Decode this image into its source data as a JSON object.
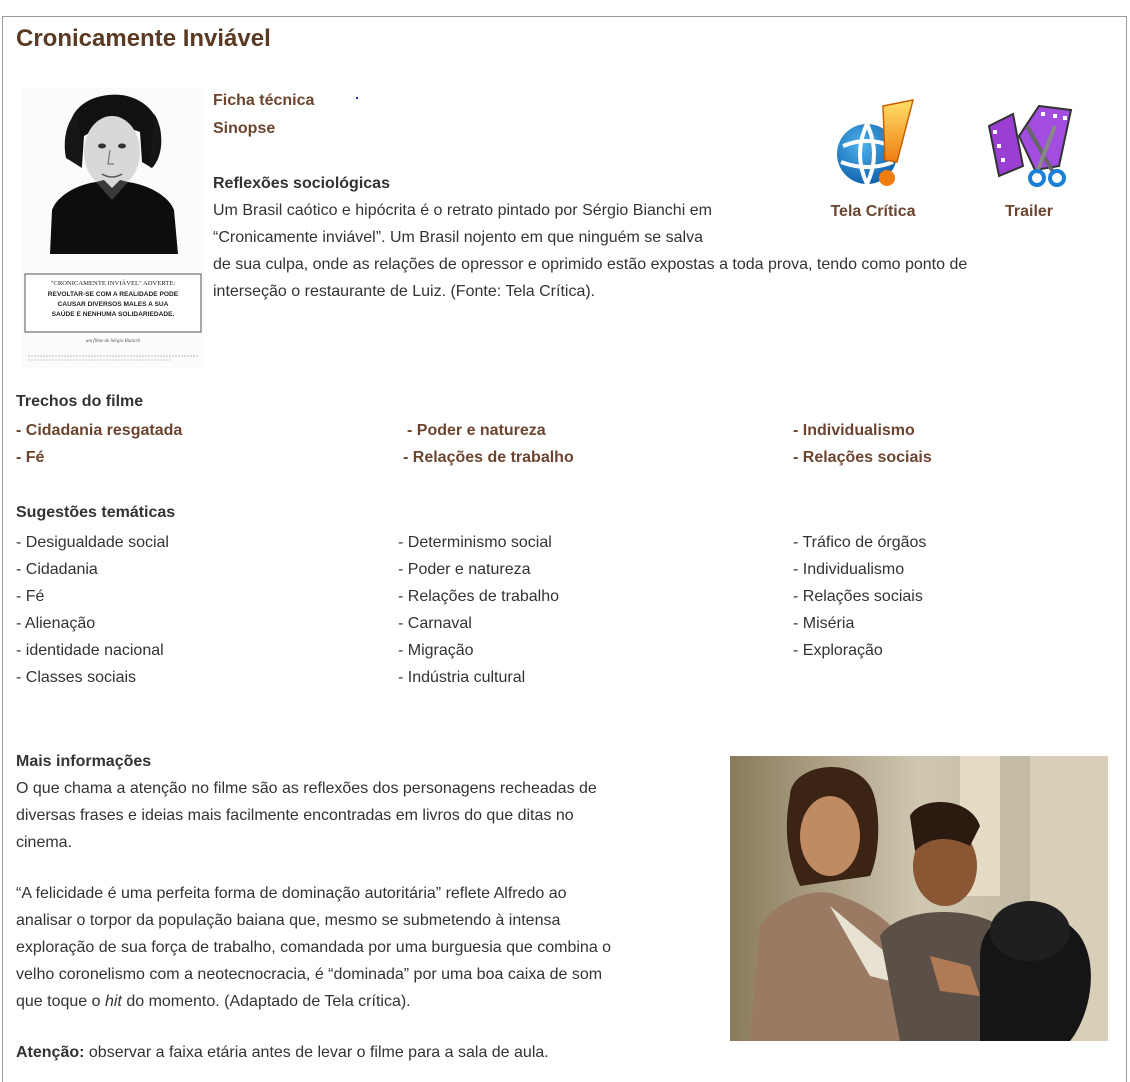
{
  "page": {
    "title": "Cronicamente Inviável"
  },
  "poster": {
    "warning_lines": [
      "\"CRONICAMENTE INVIÁVEL\" ADVERTE:",
      "REVOLTAR-SE COM A REALIDADE PODE",
      "CAUSAR DIVERSOS MALES A SUA",
      "SAÚDE E NENHUMA SOLIDARIEDADE."
    ],
    "signature": "um filme de Sérgio Bianchi"
  },
  "links": {
    "ficha": "Ficha técnica",
    "sinopse": "Sinopse"
  },
  "reflexoes": {
    "heading": "Reflexões sociológicas",
    "lines": [
      "Um Brasil caótico e hipócrita é o retrato pintado por Sérgio Bianchi em",
      "“Cronicamente inviável”. Um Brasil nojento em que ninguém se salva",
      "de sua culpa, onde as relações de opressor e oprimido estão expostas a toda prova, tendo como ponto de",
      "interseção o restaurante de Luiz. (Fonte: Tela Crítica)."
    ]
  },
  "icons": {
    "tela_critica": {
      "label": "Tela Crítica",
      "icon": "globe-exclamation-icon"
    },
    "trailer": {
      "label": "Trailer",
      "icon": "film-scissors-icon"
    }
  },
  "trechos": {
    "heading": "Trechos do filme",
    "col1": [
      "- Cidadania resgatada",
      "- Fé"
    ],
    "col2": [
      " - Poder e natureza",
      "- Relações de trabalho"
    ],
    "col3": [
      "- Individualismo",
      "- Relações sociais"
    ]
  },
  "sugestoes": {
    "heading": "Sugestões temáticas",
    "col1": [
      "- Desigualdade social",
      "- Cidadania",
      "- Fé",
      "- Alienação",
      "- identidade nacional",
      "- Classes sociais"
    ],
    "col2": [
      "- Determinismo social",
      "- Poder e natureza",
      "- Relações de trabalho",
      "- Carnaval",
      "- Migração",
      "- Indústria cultural"
    ],
    "col3": [
      "- Tráfico de órgãos",
      "- Individualismo",
      "- Relações sociais",
      "- Miséria",
      "- Exploração"
    ]
  },
  "mais": {
    "heading": "Mais informações",
    "p1": [
      "O que chama a atenção no filme são as reflexões dos personagens recheadas de",
      "diversas frases e ideias mais facilmente encontradas em livros do que ditas no",
      "cinema."
    ],
    "p2_lines": [
      "“A felicidade é uma perfeita forma de dominação autoritária” reflete Alfredo ao",
      "analisar o torpor da população baiana que, mesmo se submetendo à intensa",
      "exploração de sua força de trabalho, comandada por uma burguesia que combina o",
      "velho coronelismo com a neotecnocracia, é “dominada” por uma boa caixa de som"
    ],
    "p2_last_pre": "que toque o ",
    "p2_last_em": "hit",
    "p2_last_post": " do momento. (Adaptado de Tela crítica).",
    "atencao_label": "Atenção:",
    "atencao_text": " observar a faixa etária antes de levar o filme para a sala de aula."
  }
}
